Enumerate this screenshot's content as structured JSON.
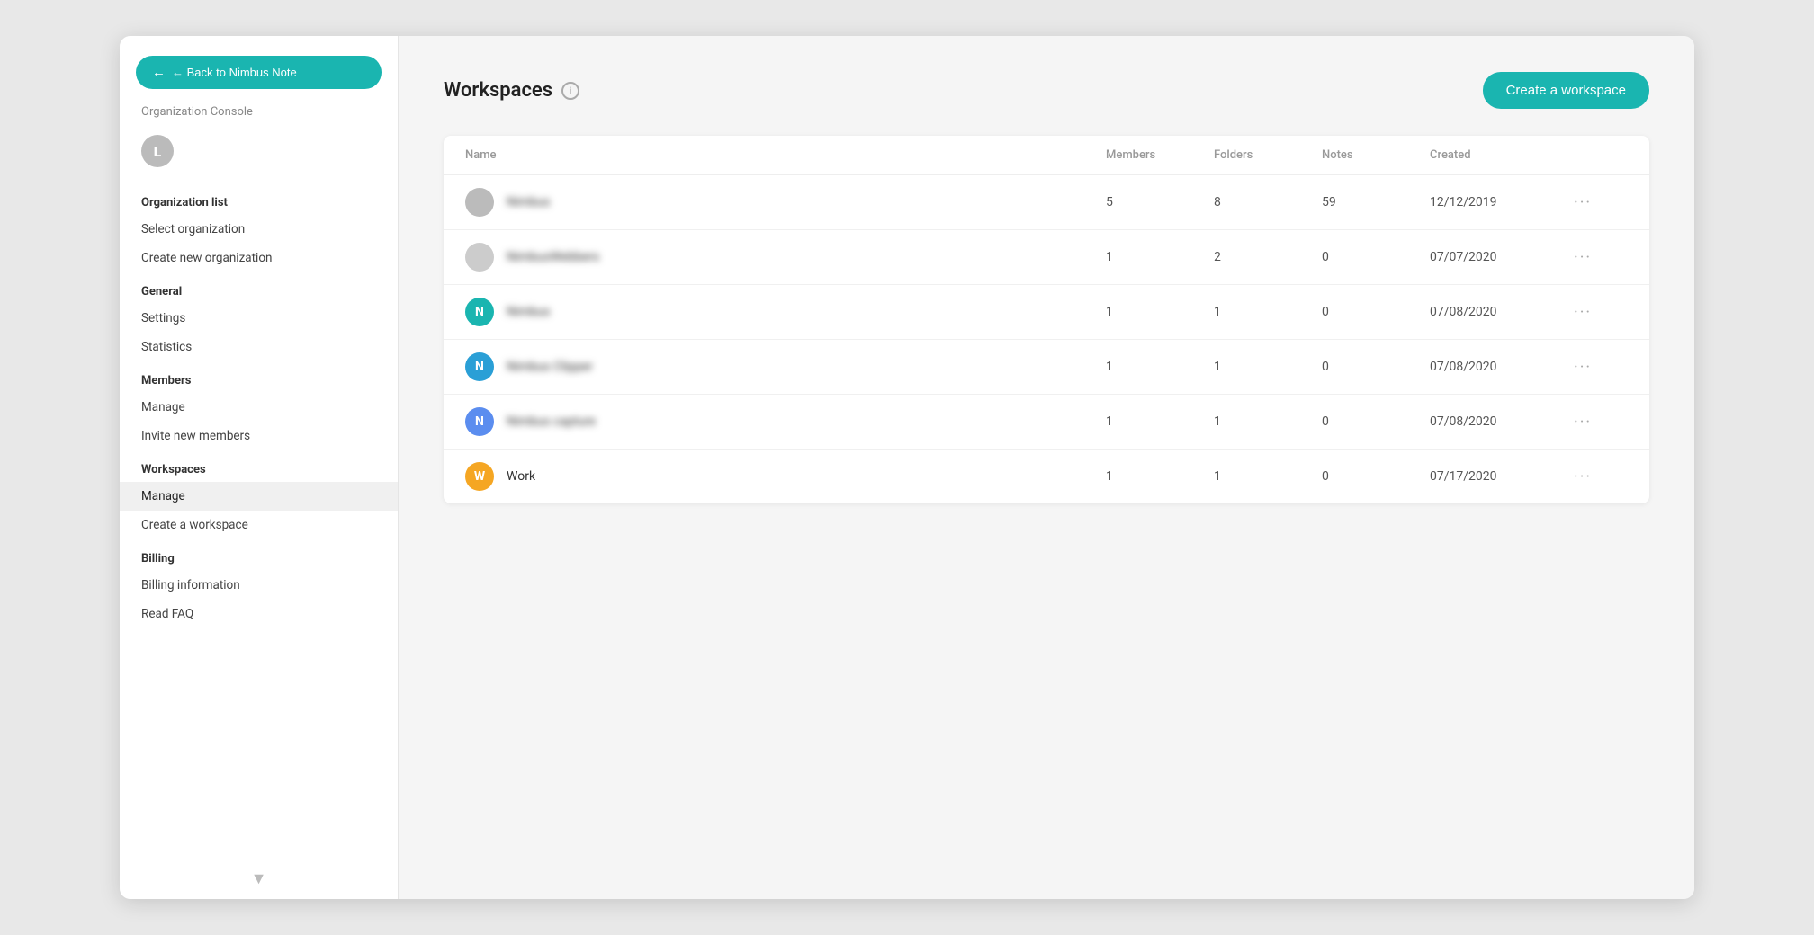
{
  "back_button": "← Back to Nimbus Note",
  "org_console_label": "Organization Console",
  "user_initial": "L",
  "sidebar": {
    "organization_list_title": "Organization list",
    "select_organization": "Select organization",
    "create_new_organization": "Create new organization",
    "general_title": "General",
    "settings": "Settings",
    "statistics": "Statistics",
    "members_title": "Members",
    "manage_members": "Manage",
    "invite_new_members": "Invite new members",
    "workspaces_title": "Workspaces",
    "manage_workspaces": "Manage",
    "create_a_workspace": "Create a workspace",
    "billing_title": "Billing",
    "billing_information": "Billing information",
    "read_faq": "Read FAQ"
  },
  "page": {
    "title": "Workspaces",
    "create_btn": "Create a workspace"
  },
  "table": {
    "headers": {
      "name": "Name",
      "members": "Members",
      "folders": "Folders",
      "notes": "Notes",
      "created": "Created"
    },
    "rows": [
      {
        "id": 1,
        "name": "Nimbus",
        "blurred": true,
        "avatar_bg": "#bbb",
        "avatar_letter": "",
        "members": 5,
        "folders": 8,
        "notes": 59,
        "created": "12/12/2019"
      },
      {
        "id": 2,
        "name": "NimbusWebbers",
        "blurred": true,
        "avatar_bg": "#ccc",
        "avatar_letter": "",
        "members": 1,
        "folders": 2,
        "notes": 0,
        "created": "07/07/2020"
      },
      {
        "id": 3,
        "name": "Nimbus",
        "blurred": true,
        "avatar_bg": "#1ab5b0",
        "avatar_letter": "N",
        "members": 1,
        "folders": 1,
        "notes": 0,
        "created": "07/08/2020"
      },
      {
        "id": 4,
        "name": "Nimbus Clipper",
        "blurred": true,
        "avatar_bg": "#2a9fd6",
        "avatar_letter": "N",
        "members": 1,
        "folders": 1,
        "notes": 0,
        "created": "07/08/2020"
      },
      {
        "id": 5,
        "name": "Nimbus capture",
        "blurred": true,
        "avatar_bg": "#5b8def",
        "avatar_letter": "N",
        "members": 1,
        "folders": 1,
        "notes": 0,
        "created": "07/08/2020"
      },
      {
        "id": 6,
        "name": "Work",
        "blurred": false,
        "avatar_bg": "#f5a623",
        "avatar_letter": "W",
        "members": 1,
        "folders": 1,
        "notes": 0,
        "created": "07/17/2020"
      }
    ]
  }
}
